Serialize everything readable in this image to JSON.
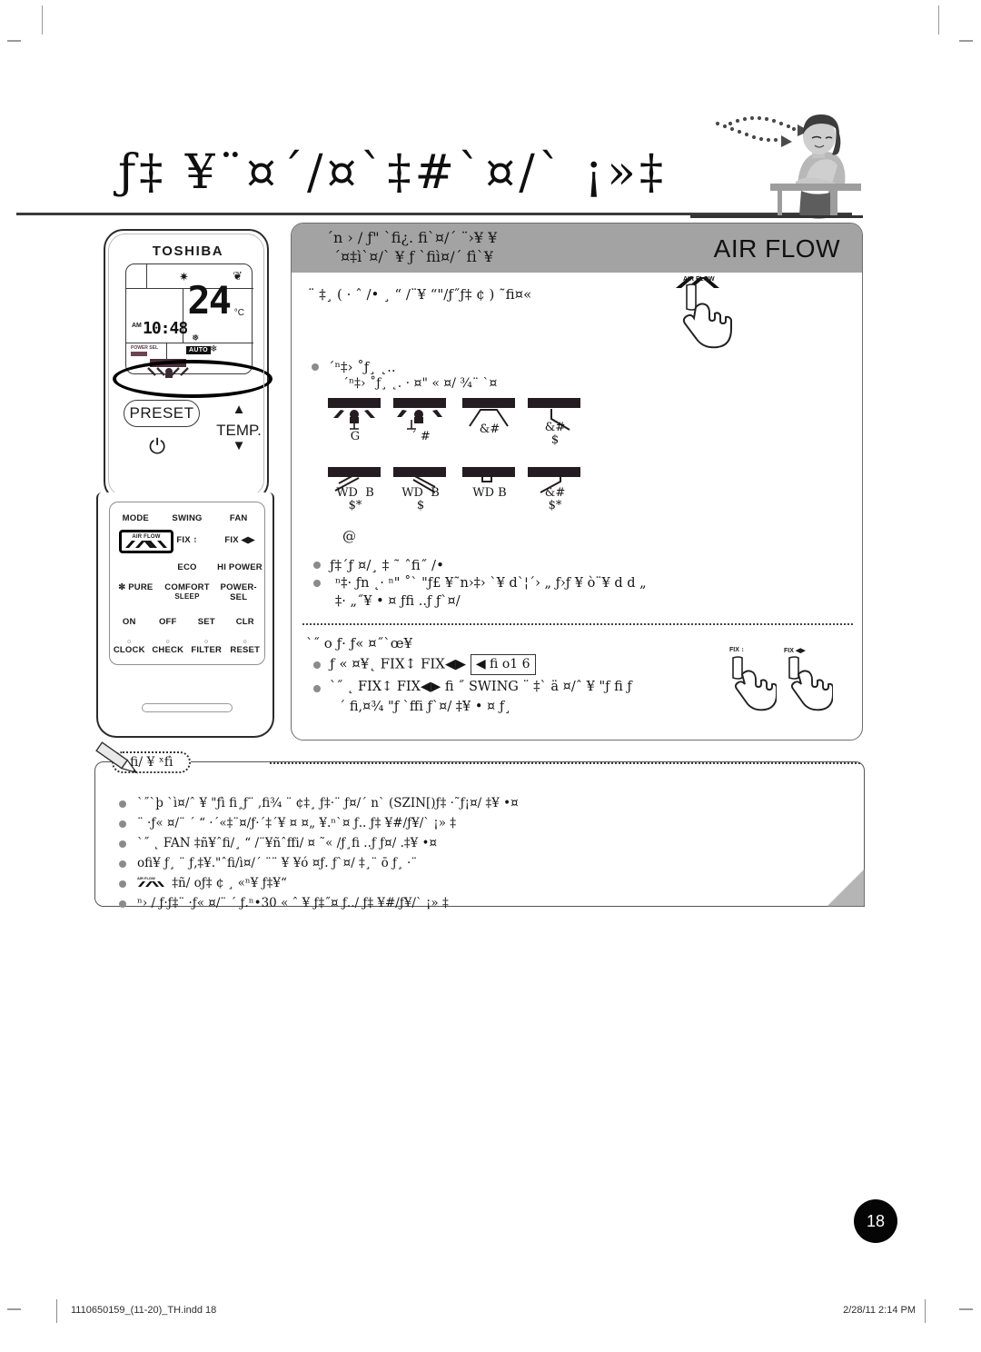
{
  "document": {
    "page_number": "18",
    "footer_file": "1110650159_(11-20)_TH.indd   18",
    "footer_timestamp": "2/28/11   2:14 PM"
  },
  "header": {
    "title_thai": "ƒ‡   ¥¨¤´/¤`‡#`¤/` ¡»‡"
  },
  "remote": {
    "brand": "TOSHIBA",
    "lcd": {
      "temperature": "24",
      "degree_unit": "°C",
      "am_label": "AM",
      "clock": "10:48",
      "auto_badge": "AUTO",
      "power_sel_label": "POWER SEL",
      "sun_icon": "✷",
      "fan_icon": "❦",
      "snowflake_icon": "❅",
      "auto_fan_icon": "❄"
    },
    "preset_label": "PRESET",
    "power_icon": "⏻",
    "temp_label": "TEMP.",
    "temp_up_icon": "▲",
    "temp_down_icon": "▼",
    "keypad": {
      "row1": [
        "MODE",
        "SWING",
        "FAN"
      ],
      "row2_air_flow": "AIR FLOW",
      "row2": [
        "FIX ↕",
        "FIX ◀▶"
      ],
      "row3": [
        "ECO",
        "HI POWER"
      ],
      "row4": [
        "PURE",
        "COMFORT",
        "SLEEP",
        "POWER-SEL"
      ],
      "row5": [
        "ON",
        "OFF",
        "SET",
        "CLR"
      ],
      "row6": [
        "CLOCK",
        "CHECK",
        "FILTER",
        "RESET"
      ],
      "pure_icon": "✼"
    }
  },
  "panel": {
    "head_thai_line1": "´n › / ƒ\" `fi¿.     fi`¤/´  ¨›¥ ¥",
    "head_thai_line2": "´¤‡ì`¤/` ¥ ƒ `fiì¤/´   fì`¥",
    "head_en": "AIR FLOW",
    "intro_line": "¨   ‡¸ ( · ˆ /• ¸ “ /¨¥  “\"/ƒ˝ƒ‡  ¢ ) ˜fi¤« ",
    "airflow_button_hint": "AIR FLOW",
    "section1_bullet": "´ⁿ‡› ˚ƒ¸ ˛..",
    "section1_sub": "´ⁿ‡› ˚ƒ¸ ˛. · ¤\" « ¤/ ¾¨ `¤",
    "diagrams_row1": [
      {
        "caption": "G",
        "type": "both-sides-person"
      },
      {
        "caption": "´ #",
        "type": "sides-person"
      },
      {
        "caption": "&#",
        "type": "wide-down"
      },
      {
        "caption": "&#\n$",
        "type": "right-down"
      }
    ],
    "diagrams_row2": [
      {
        "caption": "WD  B\n$*",
        "type": "left-up"
      },
      {
        "caption": "WD  B\n$",
        "type": "right-up"
      },
      {
        "caption": "WD  B",
        "type": "straight-down"
      },
      {
        "caption": "&#\n$*",
        "type": "left-slant"
      }
    ],
    "diagram_note": "@",
    "note_bullet_1": "ƒ‡´ƒ ¤/¸ ‡ ˜ ˆfi˝ /•",
    "note_bullet_2a": "ⁿ‡· ƒn  ˛· ⁿ\" ˚` \"ƒ£ ¥˜n›‡› `¥  d`¦´› „  ƒ›ƒ   ¥ ò¨¥ d d „",
    "note_bullet_2b": "‡· „˝¥ • ¤ ƒfi ..ƒ     ƒ`¤/",
    "section2_head": "`˝ o   ƒ· ƒ«    ¤˝`œ¥",
    "section2_line1_pre": "ƒ «     ¤¥˛ FIX↕   FIX◀▶",
    "section2_inline_key": "◀ fi o1 6",
    "section2_line2": "`˝  ˛ FIX↕    FIX◀▶  fi ˝ SWING  ¨   ‡` ä ¤/ˆ ¥ \"ƒ  fi ƒ",
    "section2_line3": "´   fi,¤¾    \"ƒ `ffi     ƒ`¤/ ‡¥ • ¤ ƒ¸",
    "hand_fix_ud": "FIX ↕",
    "hand_fix_lr": "FIX ◀▶"
  },
  "notebox": {
    "tag_label": "fi/ ¥ ˣfì",
    "lines": [
      "`˝`þ `ì¤/ˆ ¥ \"ƒì fi¸ƒ¨ ,fi¾ ¨  ¢‡¸  ƒ‡·¨ ƒ¤/´ n` (SZIN[)ƒ‡ ·˜ƒ¡¤/ ‡¥ •¤",
      "¨  ·ƒ«    ¤/¨ ´ “  ·´«‡¨¤/ƒ·´‡´¥ ¤  ¤„ ¥.ⁿ`¤ ƒ..   ƒ‡  ¥#/ƒ¥/` ¡» ‡",
      "`˝  ˛ FAN    ‡ñ¥ˆfi/¸ “ /¨¥ñˆffi/ ¤  ˜« /ƒ¸fi ..ƒ     ƒ¤/ .‡¥ •¤",
      "ofi¥ ƒ¸  ¨ ƒ‚‡¥.\"ˆfi/ì¤/´ ¨¨ ¥ ¥ó ¤ƒ.    ƒ`¤/ ‡¸¨ ō  ƒ¸  ·¨",
      "‡ñ/  oƒ‡  ¢  ¸  «ⁿ¥ ƒ‡¥“",
      "ⁿ› / ƒ·ƒ‡¨ ·ƒ«   ¤/¨ ´ ƒ.ⁿ•30  «  ˆ ¥ ƒ‡˝¤ ƒ../  ƒ‡  ¥#/ƒ¥/` ¡» ‡"
    ],
    "airflow_icon_label": "AIR FLOW"
  }
}
